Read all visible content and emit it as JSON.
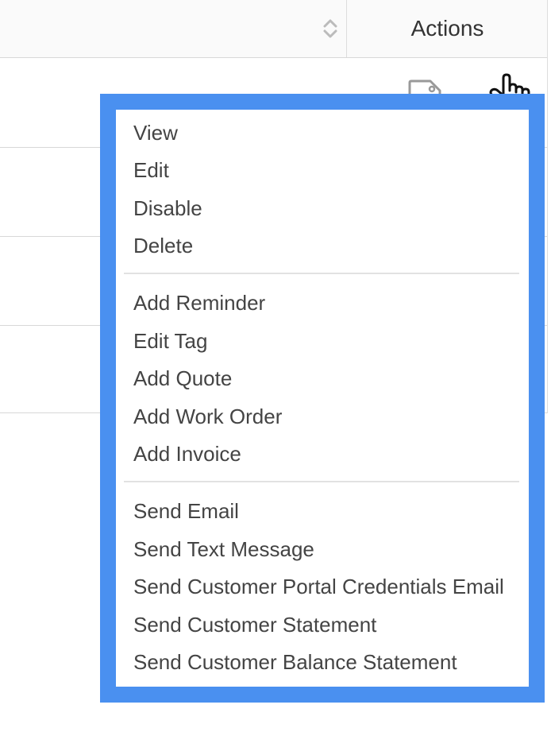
{
  "table": {
    "actions_header": "Actions"
  },
  "menu": {
    "group1": [
      "View",
      "Edit",
      "Disable",
      "Delete"
    ],
    "group2": [
      "Add Reminder",
      "Edit Tag",
      "Add Quote",
      "Add Work Order",
      "Add Invoice"
    ],
    "group3": [
      "Send Email",
      "Send Text Message",
      "Send Customer Portal Credentials Email",
      "Send Customer Statement",
      "Send Customer Balance Statement"
    ]
  },
  "colors": {
    "highlight_border": "#4a90f0",
    "row_border": "#d8d8d8",
    "header_bg": "#fafafa",
    "menu_text": "#444444"
  },
  "icons": {
    "sort": "sort-icon",
    "tag": "tag-icon",
    "pointer": "pointer-hand-icon"
  }
}
